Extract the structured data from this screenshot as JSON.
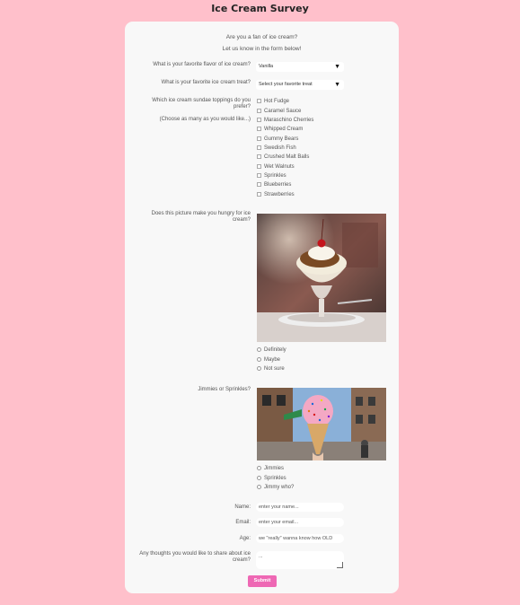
{
  "title": "Ice Cream Survey",
  "intro": [
    "Are you a fan of ice cream?",
    "Let us know in the form below!"
  ],
  "flavor": {
    "label": "What is your favorite flavor of ice cream?",
    "value": "Vanilla"
  },
  "treat": {
    "label": "What is your favorite ice cream treat?",
    "value": "Select your favorite treat"
  },
  "toppings": {
    "label_line1": "Which ice cream sundae toppings do you prefer?",
    "label_line2": "(Choose as many as you would like...)",
    "options": [
      "Hot Fudge",
      "Caramel Sauce",
      "Maraschino Cherries",
      "Whipped Cream",
      "Gummy Bears",
      "Swedish Fish",
      "Crushed Malt Balls",
      "Wet Walnuts",
      "Sprinkles",
      "Blueberries",
      "Strawberries"
    ]
  },
  "hungry": {
    "label": "Does this picture make you hungry for ice cream?",
    "options": [
      "Definitely",
      "Maybe",
      "Not sure"
    ]
  },
  "jimmies": {
    "label": "Jimmies or Sprinkles?",
    "options": [
      "Jimmies",
      "Sprinkles",
      "Jimmy who?"
    ]
  },
  "name": {
    "label": "Name:",
    "placeholder": "enter your name..."
  },
  "email": {
    "label": "Email:",
    "placeholder": "enter your email..."
  },
  "age": {
    "label": "Age:",
    "placeholder": "we \"really\" wanna know how OLD"
  },
  "thoughts": {
    "label": "Any thoughts you would like to share about ice cream?",
    "placeholder": "..."
  },
  "submit_label": "Submit",
  "colors": {
    "background": "#ffc0cb",
    "card": "#f8f8f8",
    "submit": "#ee68b4"
  }
}
